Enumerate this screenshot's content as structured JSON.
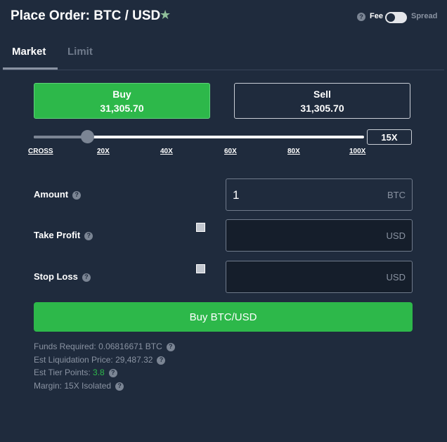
{
  "header": {
    "title": "Place Order: BTC / USD",
    "star_icon": "star-icon",
    "fee_label": "Fee",
    "spread_label": "Spread"
  },
  "tabs": [
    {
      "label": "Market",
      "active": true
    },
    {
      "label": "Limit",
      "active": false
    }
  ],
  "buy": {
    "label": "Buy",
    "price": "31,305.70"
  },
  "sell": {
    "label": "Sell",
    "price": "31,305.70"
  },
  "leverage": {
    "value": "15X",
    "level": 15,
    "max": 100,
    "ticks": [
      "CROSS",
      "20X",
      "40X",
      "60X",
      "80X",
      "100X"
    ]
  },
  "form": {
    "amount": {
      "label": "Amount",
      "value": "1",
      "unit": "BTC"
    },
    "take_profit": {
      "label": "Take Profit",
      "value": "",
      "unit": "USD"
    },
    "stop_loss": {
      "label": "Stop Loss",
      "value": "",
      "unit": "USD"
    }
  },
  "submit_label": "Buy BTC/USD",
  "info": {
    "funds_label": "Funds Required:",
    "funds_value": "0.06816671 BTC",
    "liq_label": "Est Liquidation Price:",
    "liq_value": "29,487.32",
    "tier_label": "Est Tier Points:",
    "tier_value": "3.8",
    "margin_label": "Margin:",
    "margin_value": "15X Isolated"
  },
  "colors": {
    "background": "#1f2b3d",
    "buy_green": "#2db84a",
    "muted_text": "#8a93a2"
  }
}
